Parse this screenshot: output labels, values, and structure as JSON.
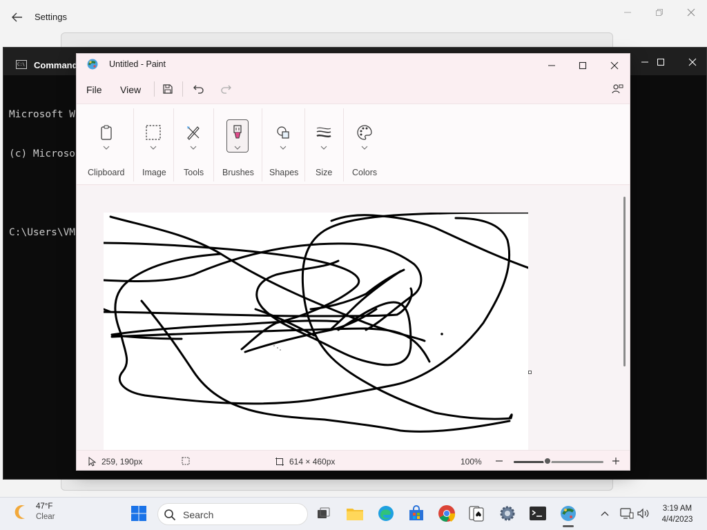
{
  "settings": {
    "title": "Settings"
  },
  "cmd": {
    "tab_title": "Command",
    "lines": [
      "Microsoft W",
      "(c) Microso",
      "",
      "C:\\Users\\VM"
    ]
  },
  "paint": {
    "title": "Untitled - Paint",
    "menu": {
      "file": "File",
      "view": "View"
    },
    "ribbon": [
      {
        "label": "Clipboard",
        "icon": "clipboard-icon"
      },
      {
        "label": "Image",
        "icon": "select-rectangle-icon"
      },
      {
        "label": "Tools",
        "icon": "pencil-tools-icon"
      },
      {
        "label": "Brushes",
        "icon": "brush-icon"
      },
      {
        "label": "Shapes",
        "icon": "shapes-icon"
      },
      {
        "label": "Size",
        "icon": "line-size-icon"
      },
      {
        "label": "Colors",
        "icon": "palette-icon"
      }
    ],
    "status": {
      "cursor_pos": "259, 190px",
      "canvas_size": "614 × 460px",
      "zoom": "100%",
      "zoom_fraction": 0.38
    }
  },
  "taskbar": {
    "weather_temp": "47°F",
    "weather_cond": "Clear",
    "search_label": "Search",
    "time": "3:19 AM",
    "date": "4/4/2023"
  },
  "colors": {
    "paint_chrome": "#fbeff2",
    "console_bg": "#0c0c0c",
    "taskbar_bg": "#eef0f5",
    "stroke": "#000000"
  }
}
